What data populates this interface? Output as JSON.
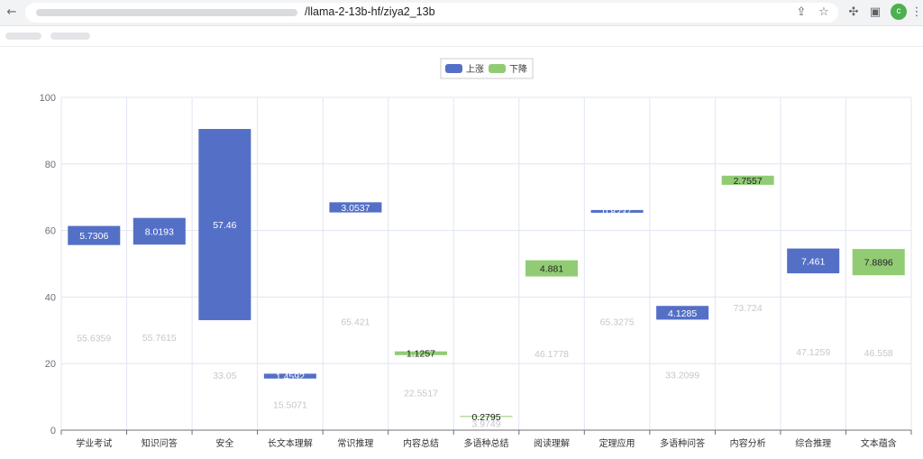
{
  "browser": {
    "url_visible": "/llama-2-13b-hf/ziya2_13b",
    "profile_initial": "c"
  },
  "icons": {
    "back": "back-arrow-icon",
    "share": "share-icon",
    "bookmark": "star-icon",
    "extensions": "puzzle-icon",
    "sidebar": "sidebar-icon",
    "menu": "more-vert-icon"
  },
  "colors": {
    "rise": "#5470c6",
    "fall": "#91cc75",
    "base_label": "#c6c7cc",
    "grid": "#e0e6f1",
    "axis": "#6e7079"
  },
  "chart_data": {
    "type": "bar",
    "subtype": "waterfall",
    "legend": [
      "上涨",
      "下降"
    ],
    "legend_position": "top-center",
    "grid": true,
    "ylim": [
      0,
      100
    ],
    "yticks": [
      0,
      20,
      40,
      60,
      80,
      100
    ],
    "categories": [
      "学业考试",
      "知识问答",
      "安全",
      "长文本理解",
      "常识推理",
      "内容总结",
      "多语种总结",
      "阅读理解",
      "定理应用",
      "多语种问答",
      "内容分析",
      "综合推理",
      "文本蕴含"
    ],
    "base": [
      55.6359,
      55.7615,
      33.05,
      15.5071,
      65.421,
      22.5517,
      3.9749,
      46.1778,
      65.3275,
      33.2099,
      73.724,
      47.1259,
      46.558
    ],
    "change": [
      5.7306,
      8.0193,
      57.46,
      1.4592,
      3.0537,
      1.1257,
      0.2795,
      4.881,
      0.8237,
      4.1285,
      2.7557,
      7.461,
      7.8896
    ],
    "direction": [
      "up",
      "up",
      "up",
      "up",
      "up",
      "down",
      "down",
      "down",
      "up",
      "up",
      "down",
      "up",
      "down"
    ],
    "base_labels": [
      "55.6359",
      "55.7615",
      "33.05",
      "15.5071",
      "65.421",
      "22.5517",
      "3.9749",
      "46.1778",
      "65.3275",
      "33.2099",
      "73.724",
      "47.1259",
      "46.558"
    ],
    "change_labels": [
      "5.7306",
      "8.0193",
      "57.46",
      "1.4592",
      "3.0537",
      "1.1257",
      "0.2795",
      "4.881",
      "0.8237",
      "4.1285",
      "2.7557",
      "7.461",
      "7.8896"
    ]
  }
}
